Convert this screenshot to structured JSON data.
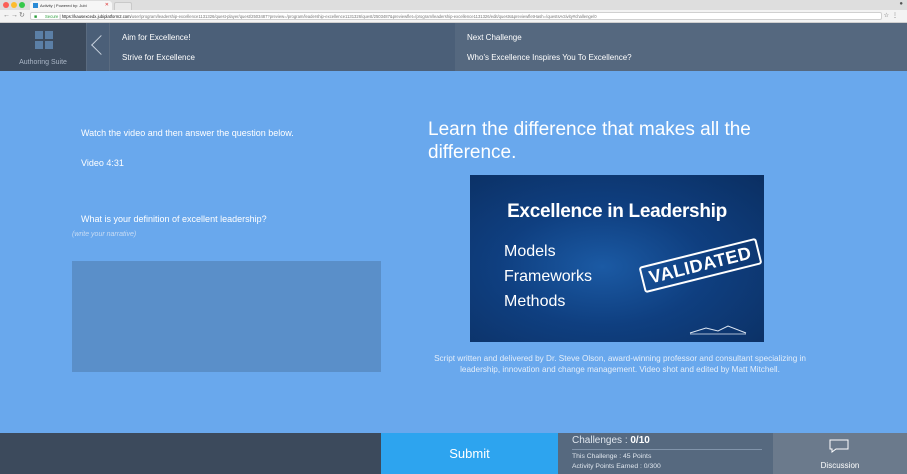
{
  "browser": {
    "tab_title": "Activity | Powered by: Jubi",
    "url_secure_label": "Secure",
    "url_host": "https://kausexcedx.jubiplatform2.com",
    "url_path": "/user/program/leadership-excellence1131326/quest-player/quest/2503487?preview=/program/leadership-excellence1131326/quest/2503487&previewflet=/program/leadership-excellence1131326/edit/quests&previewfletHash=/questsActivity#challenge/0",
    "traffic_colors": [
      "#fc5f57",
      "#fdbc2e",
      "#34c84a"
    ]
  },
  "header": {
    "suite_label": "Authoring Suite",
    "quest_title": "Aim for Excellence!",
    "challenge_title": "Strive for Excellence",
    "next_label": "Next Challenge",
    "next_title": "Who's Excellence Inspires You To Excellence?"
  },
  "content": {
    "instruction": "Watch the video and then answer the question below.",
    "video_length": "Video 4:31",
    "question": "What is your definition of excellent leadership?",
    "answer_placeholder": "(write your narrative)",
    "headline": "Learn the difference that makes all the difference.",
    "video": {
      "title": "Excellence in Leadership",
      "lines": [
        "Models",
        "Frameworks",
        "Methods"
      ],
      "stamp": "VALIDATED"
    },
    "script_credit": "Script written and delivered by Dr. Steve Olson, award-winning professor and consultant specializing in leadership, innovation and change management. Video shot and edited by Matt Mitchell."
  },
  "footer": {
    "submit_label": "Submit",
    "challenges_label": "Challenges : ",
    "challenges_value": "0/10",
    "this_challenge": "This Challenge : 45 Points",
    "points_earned": "Activity Points Earned : 0/300",
    "discussion_label": "Discussion"
  },
  "colors": {
    "content_bg": "#69a8ed",
    "header_bg": "#4b5f78",
    "submit_bg": "#2da4ef",
    "footer_bg": "#3c4a5c"
  }
}
